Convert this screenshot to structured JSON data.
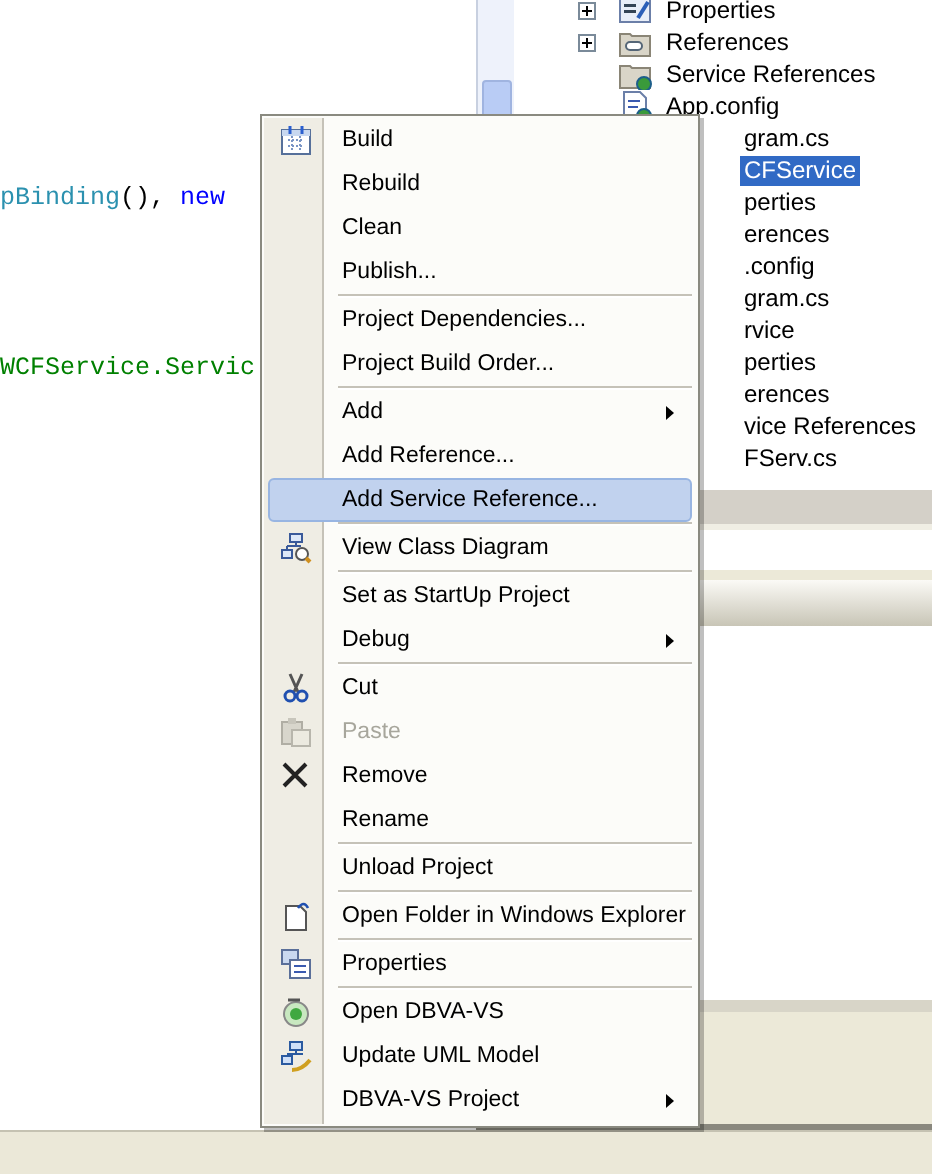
{
  "editor": {
    "lines": [
      {
        "segments": [
          {
            "text": "pBinding",
            "kind": "type"
          },
          {
            "text": "(), ",
            "kind": "plain"
          },
          {
            "text": "new",
            "kind": "keyword"
          }
        ]
      },
      {
        "segments": [
          {
            "text": "WCFService.Servic",
            "kind": "string"
          }
        ]
      }
    ]
  },
  "solution_explorer": {
    "items": [
      {
        "label": "Properties",
        "kind": "properties",
        "expandable": true,
        "selected": false
      },
      {
        "label": "References",
        "kind": "references",
        "expandable": true,
        "selected": false
      },
      {
        "label": "Service References",
        "kind": "service-folder",
        "expandable": false,
        "selected": false
      },
      {
        "label": "App.config",
        "kind": "config",
        "expandable": false,
        "selected": false
      },
      {
        "label": "gram.cs",
        "kind": "partial",
        "selected": false
      },
      {
        "label": "CFService",
        "kind": "partial",
        "selected": true
      },
      {
        "label": "perties",
        "kind": "partial",
        "selected": false
      },
      {
        "label": "erences",
        "kind": "partial",
        "selected": false
      },
      {
        "label": ".config",
        "kind": "partial",
        "selected": false
      },
      {
        "label": "gram.cs",
        "kind": "partial",
        "selected": false
      },
      {
        "label": "rvice",
        "kind": "partial",
        "selected": false
      },
      {
        "label": "perties",
        "kind": "partial",
        "selected": false
      },
      {
        "label": "erences",
        "kind": "partial",
        "selected": false
      },
      {
        "label": "vice References",
        "kind": "partial",
        "selected": false
      },
      {
        "label": "FServ.cs",
        "kind": "partial",
        "selected": false
      }
    ]
  },
  "context_menu": {
    "items": [
      {
        "kind": "item",
        "label": "Build",
        "submenu": false,
        "disabled": false,
        "selected": false
      },
      {
        "kind": "item",
        "label": "Rebuild",
        "submenu": false,
        "disabled": false,
        "selected": false
      },
      {
        "kind": "item",
        "label": "Clean",
        "submenu": false,
        "disabled": false,
        "selected": false
      },
      {
        "kind": "item",
        "label": "Publish...",
        "submenu": false,
        "disabled": false,
        "selected": false
      },
      {
        "kind": "separator"
      },
      {
        "kind": "item",
        "label": "Project Dependencies...",
        "submenu": false,
        "disabled": false,
        "selected": false
      },
      {
        "kind": "item",
        "label": "Project Build Order...",
        "submenu": false,
        "disabled": false,
        "selected": false
      },
      {
        "kind": "separator"
      },
      {
        "kind": "item",
        "label": "Add",
        "submenu": true,
        "disabled": false,
        "selected": false
      },
      {
        "kind": "item",
        "label": "Add Reference...",
        "submenu": false,
        "disabled": false,
        "selected": false
      },
      {
        "kind": "item",
        "label": "Add Service Reference...",
        "submenu": false,
        "disabled": false,
        "selected": true
      },
      {
        "kind": "separator"
      },
      {
        "kind": "item",
        "label": "View Class Diagram",
        "submenu": false,
        "disabled": false,
        "selected": false
      },
      {
        "kind": "separator"
      },
      {
        "kind": "item",
        "label": "Set as StartUp Project",
        "submenu": false,
        "disabled": false,
        "selected": false
      },
      {
        "kind": "item",
        "label": "Debug",
        "submenu": true,
        "disabled": false,
        "selected": false
      },
      {
        "kind": "separator"
      },
      {
        "kind": "item",
        "label": "Cut",
        "submenu": false,
        "disabled": false,
        "selected": false
      },
      {
        "kind": "item",
        "label": "Paste",
        "submenu": false,
        "disabled": true,
        "selected": false
      },
      {
        "kind": "item",
        "label": "Remove",
        "submenu": false,
        "disabled": false,
        "selected": false
      },
      {
        "kind": "item",
        "label": "Rename",
        "submenu": false,
        "disabled": false,
        "selected": false
      },
      {
        "kind": "separator"
      },
      {
        "kind": "item",
        "label": "Unload Project",
        "submenu": false,
        "disabled": false,
        "selected": false
      },
      {
        "kind": "separator"
      },
      {
        "kind": "item",
        "label": "Open Folder in Windows Explorer",
        "submenu": false,
        "disabled": false,
        "selected": false
      },
      {
        "kind": "separator"
      },
      {
        "kind": "item",
        "label": "Properties",
        "submenu": false,
        "disabled": false,
        "selected": false
      },
      {
        "kind": "separator"
      },
      {
        "kind": "item",
        "label": "Open DBVA-VS",
        "submenu": false,
        "disabled": false,
        "selected": false
      },
      {
        "kind": "item",
        "label": "Update UML Model",
        "submenu": false,
        "disabled": false,
        "selected": false
      },
      {
        "kind": "item",
        "label": "DBVA-VS Project",
        "submenu": true,
        "disabled": false,
        "selected": false
      }
    ]
  }
}
